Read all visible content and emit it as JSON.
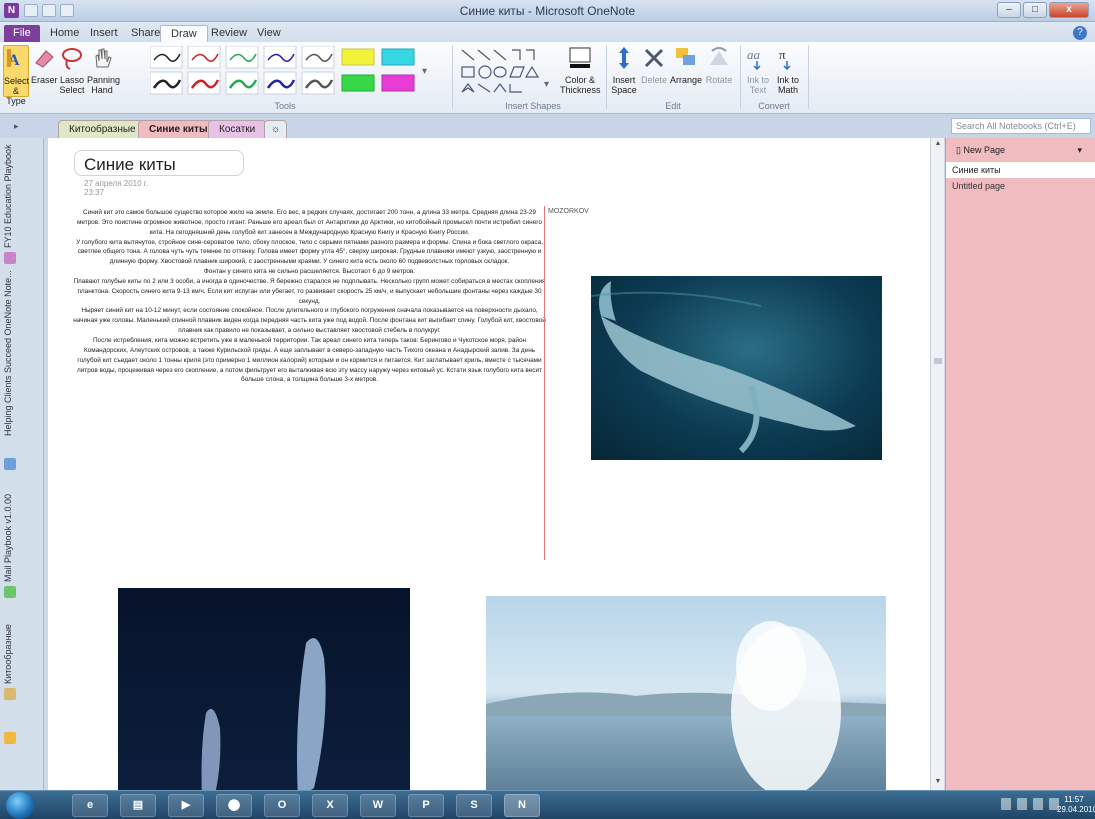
{
  "window": {
    "title": "Синие киты - Microsoft OneNote",
    "minimize": "–",
    "maximize": "□",
    "close": "x"
  },
  "app_icon_label": "N",
  "ribbon_tabs": [
    "File",
    "Home",
    "Insert",
    "Share",
    "Draw",
    "Review",
    "View"
  ],
  "ribbon": {
    "tools": {
      "select": "Select & Type",
      "eraser": "Eraser",
      "lasso": "Lasso Select",
      "panning": "Panning Hand",
      "group_label": "Tools"
    },
    "insert_shapes": {
      "color_thickness": "Color & Thickness",
      "group_label": "Insert Shapes"
    },
    "edit": {
      "insert_space": "Insert Space",
      "delete": "Delete",
      "arrange": "Arrange",
      "rotate": "Rotate",
      "group_label": "Edit"
    },
    "convert": {
      "ink_to_text": "Ink to Text",
      "ink_to_math": "Ink to Math",
      "group_label": "Convert"
    }
  },
  "sections": [
    "Китообразные",
    "Синие киты",
    "Косатки"
  ],
  "search_placeholder": "Search All Notebooks (Ctrl+E)",
  "notebooks": [
    "FY10 Education Playbook",
    "Helping Clients Succeed OneNote Note...",
    "Mail Playbook v1.0.00",
    "Китообразные"
  ],
  "page": {
    "title": "Синие киты",
    "date": "27 апреля 2010 г.",
    "time": "23:37",
    "author": "MOZORKOV",
    "paragraphs": [
      "Синий кит это самое большое существо которое жило на земле. Его вес, в редких случаях, достигает 200 тонн, а длина 33 метра. Средняя длина 23-29 метров. Это поистине огромное животное, просто гигант. Раньше его ареал был от Антарктики до Арктики, но китобойный промысел почти истребил синего кита. На сегодняшний день голубой кит занесен в Международную Красную Книгу и Красную Книгу России.",
      "У голубого кита вытянутое, стройное сине-сероватое тело, сбоку плоское, тело с серыми пятнами разного размера и формы. Спина и бока светлого окраса, светлее общего тона. А голова чуть чуть темнее по оттенку. Голова имеет форму угла 45°, сверху широкая. Грудные плавники имеют узкую, заостренную и длинную форму. Хвостовой плавник широкий, с заостренными краями. У синего кита есть около 60 подвеволстных горловых складок.",
      "Фонтан у синего кита не сильно расшеляется. Высотаот 6 до 9 метров.",
      "Плавают голубые киты по 2 или 3 особи, а иногда в одиночестве. Я бережно старался не подплывать. Несколько групп может собираться в местах скопления планктона. Скорость синего кита 9-13 км/ч. Если кит испуган или убегает, то развивает скорость 25 км/ч, и выпускает небольшие фонтаны через каждые 30 секунд.",
      "Ныряет синий кит на 10-12 минут, если состояние спокойное. После длительного и глубокого погружения сначала показывается на поверхности дыхало, начиная уже головы. Маленький спинной плавник виден когда передняя часть кита уже под водой. После фонтана кит выгибает спину. Голубой кит, хвостовой плавник как правило не показывает, а сильно выставляет хвостовой стебель в полукруг.",
      "После истребления, кита можно встретить уже в маленькой территории. Так ареал синего кита теперь таков: Берингово и Чукотское моря, район Командорских, Алеутских островов, а также Курильской гряды. А еще заплывает в северо-западную часть Тихого океана и Анадырский залив. За день голубой кит съедает около 1 тонны криля (это примерно 1 миллион калорий) которым и он кормится и питается. Кит заглатывает криль, вместе с тысячами литров воды, процеживая через его скопление, а потом фильтрует его выталкивая всю эту массу наружу через китовый ус. Кстати язык голубого кита весит больше слона, а толщина больше 3-х метров."
    ]
  },
  "page_list": {
    "new_page": "New Page",
    "items": [
      "Синие киты",
      "Untitled page"
    ]
  },
  "taskbar": {
    "time": "11:57",
    "date": "29.04.2010",
    "apps": [
      "IE",
      "Explorer",
      "Media",
      "Ext",
      "Outlook",
      "Excel",
      "Word",
      "PowerPoint",
      "Other",
      "OneNote"
    ],
    "app_labels": [
      "e",
      "▤",
      "▶",
      "⬤",
      "O",
      "X",
      "W",
      "P",
      "S",
      "N"
    ]
  },
  "colors": {
    "file_tab": "#7d3f9c",
    "page_list_bg": "#f1bcbf",
    "link": "#1b52c7",
    "margin_line": "#d97b7b"
  }
}
